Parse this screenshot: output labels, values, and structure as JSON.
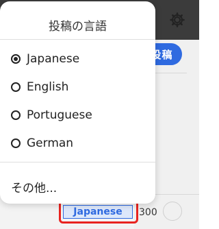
{
  "app": {
    "post_button_label": "投稿",
    "language_indicator": "Japanese",
    "char_count": "300",
    "gear_icon": "gear-icon"
  },
  "menu": {
    "title": "投稿の言語",
    "options": [
      {
        "label": "Japanese",
        "selected": true
      },
      {
        "label": "English",
        "selected": false
      },
      {
        "label": "Portuguese",
        "selected": false
      },
      {
        "label": "German",
        "selected": false
      }
    ],
    "other_label": "その他..."
  },
  "colors": {
    "accent": "#2f6ae0",
    "highlight": "#e8231f"
  }
}
